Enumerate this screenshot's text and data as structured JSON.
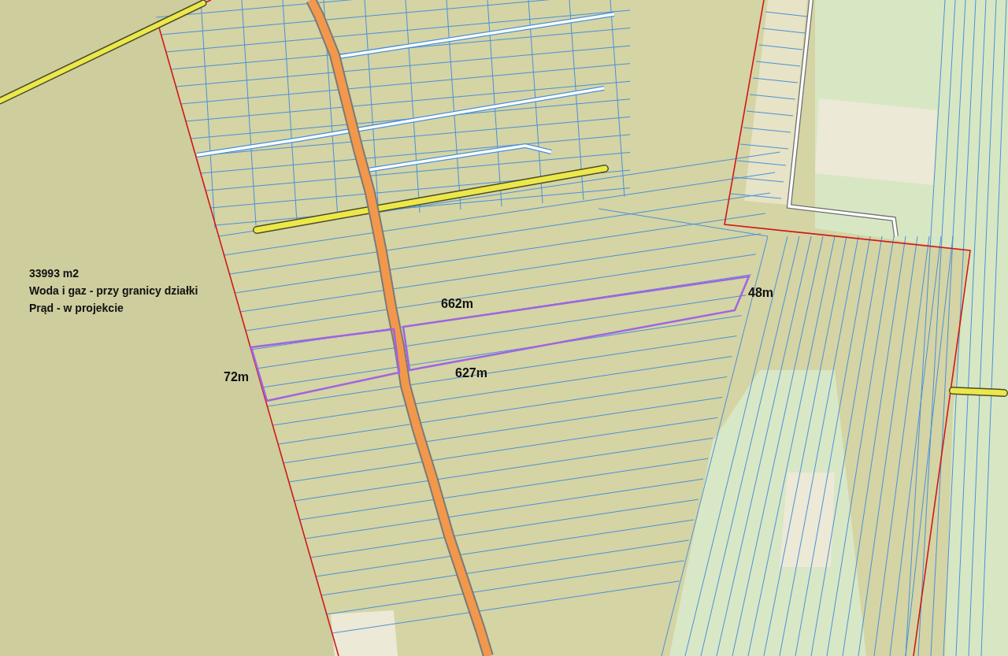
{
  "map": {
    "area": "33993 m2",
    "notes": [
      "Woda i gaz - przy granicy działki",
      "Prąd - w projekcie"
    ],
    "plot_dimensions": [
      "662m",
      "48m",
      "72m",
      "627m"
    ]
  }
}
